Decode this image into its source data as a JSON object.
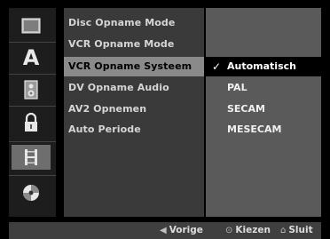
{
  "sidebar": {
    "items": [
      {
        "icon": "disc-icon",
        "active": false
      },
      {
        "icon": "language-a-icon",
        "active": false,
        "label": "A"
      },
      {
        "icon": "speaker-icon",
        "active": false
      },
      {
        "icon": "lock-icon",
        "active": false
      },
      {
        "icon": "film-icon",
        "active": true
      },
      {
        "icon": "disc-reel-icon",
        "active": false
      }
    ]
  },
  "menu": {
    "items": [
      {
        "label": "Disc Opname Mode",
        "active": false
      },
      {
        "label": "VCR Opname Mode",
        "active": false
      },
      {
        "label": "VCR Opname Systeem",
        "active": true
      },
      {
        "label": "DV Opname Audio",
        "active": false
      },
      {
        "label": "AV2 Opnemen",
        "active": false
      },
      {
        "label": "Auto Periode",
        "active": false
      }
    ]
  },
  "options": {
    "check_glyph": "✓",
    "items": [
      {
        "label": "Automatisch",
        "selected": true
      },
      {
        "label": "PAL",
        "selected": false
      },
      {
        "label": "SECAM",
        "selected": false
      },
      {
        "label": "MESECAM",
        "selected": false
      }
    ]
  },
  "footer": {
    "back": {
      "glyph": "◀",
      "label": "Vorige"
    },
    "select": {
      "glyph": "⊙",
      "label": "Kiezen"
    },
    "close": {
      "glyph": "⌂",
      "label": "Sluit"
    }
  },
  "colors": {
    "active_menu": "#8a8a8a",
    "selected_option": "#000000",
    "active_icon_tile": "#6e6e6e"
  }
}
